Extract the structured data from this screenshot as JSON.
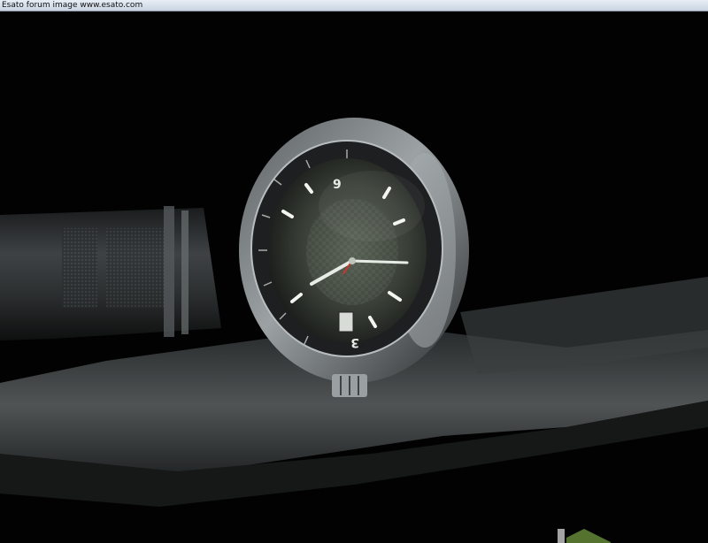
{
  "banner": {
    "text": "Esato forum image www.esato.com"
  },
  "photo": {
    "subject": "wristwatch-photo",
    "dial_numerals": [
      "9",
      "3"
    ],
    "colors": {
      "background": "#020202",
      "dial": "#3a4038",
      "bezel": "#262626",
      "steel": "#8a8f92",
      "cloth": "#5a5f60",
      "lume": "#f2f5f0",
      "accent_hand": "#c0392b"
    }
  }
}
